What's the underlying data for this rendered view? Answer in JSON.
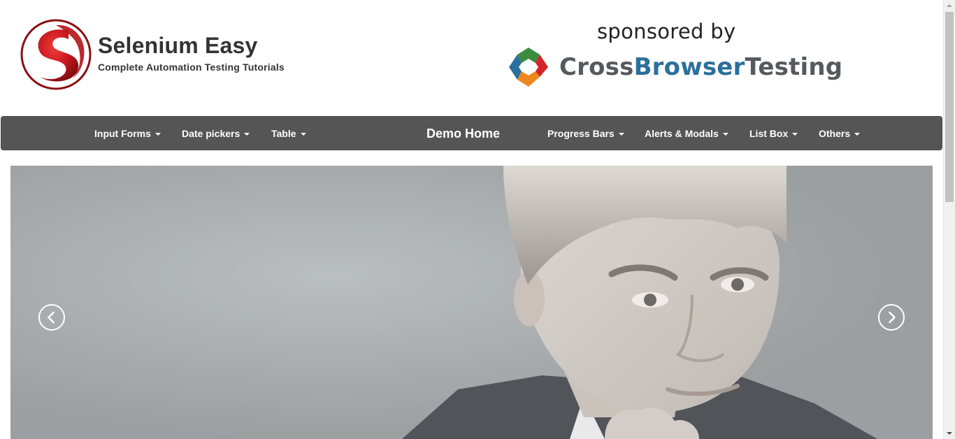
{
  "header": {
    "brand_title": "Selenium Easy",
    "brand_tagline": "Complete Automation Testing Tutorials",
    "logo_icon": "selenium-easy-logo",
    "sponsor_caption": "sponsored by",
    "sponsor_name_part1": "Cross",
    "sponsor_name_part2": "Browser",
    "sponsor_name_part3": "Testing",
    "sponsor_icon": "crossbrowsertesting-logo"
  },
  "navbar": {
    "items_left": [
      {
        "label": "Input Forms",
        "dropdown": true
      },
      {
        "label": "Date pickers",
        "dropdown": true
      },
      {
        "label": "Table",
        "dropdown": true
      }
    ],
    "home_label": "Demo Home",
    "items_right": [
      {
        "label": "Progress Bars",
        "dropdown": true
      },
      {
        "label": "Alerts & Modals",
        "dropdown": true
      },
      {
        "label": "List Box",
        "dropdown": true
      },
      {
        "label": "Others",
        "dropdown": true
      }
    ]
  },
  "carousel": {
    "prev_icon": "chevron-left-icon",
    "next_icon": "chevron-right-icon"
  },
  "colors": {
    "navbar_bg": "#555555",
    "brand_red": "#c4161c",
    "sponsor_blue": "#2b6f9c",
    "sponsor_gray": "#555a5f"
  }
}
